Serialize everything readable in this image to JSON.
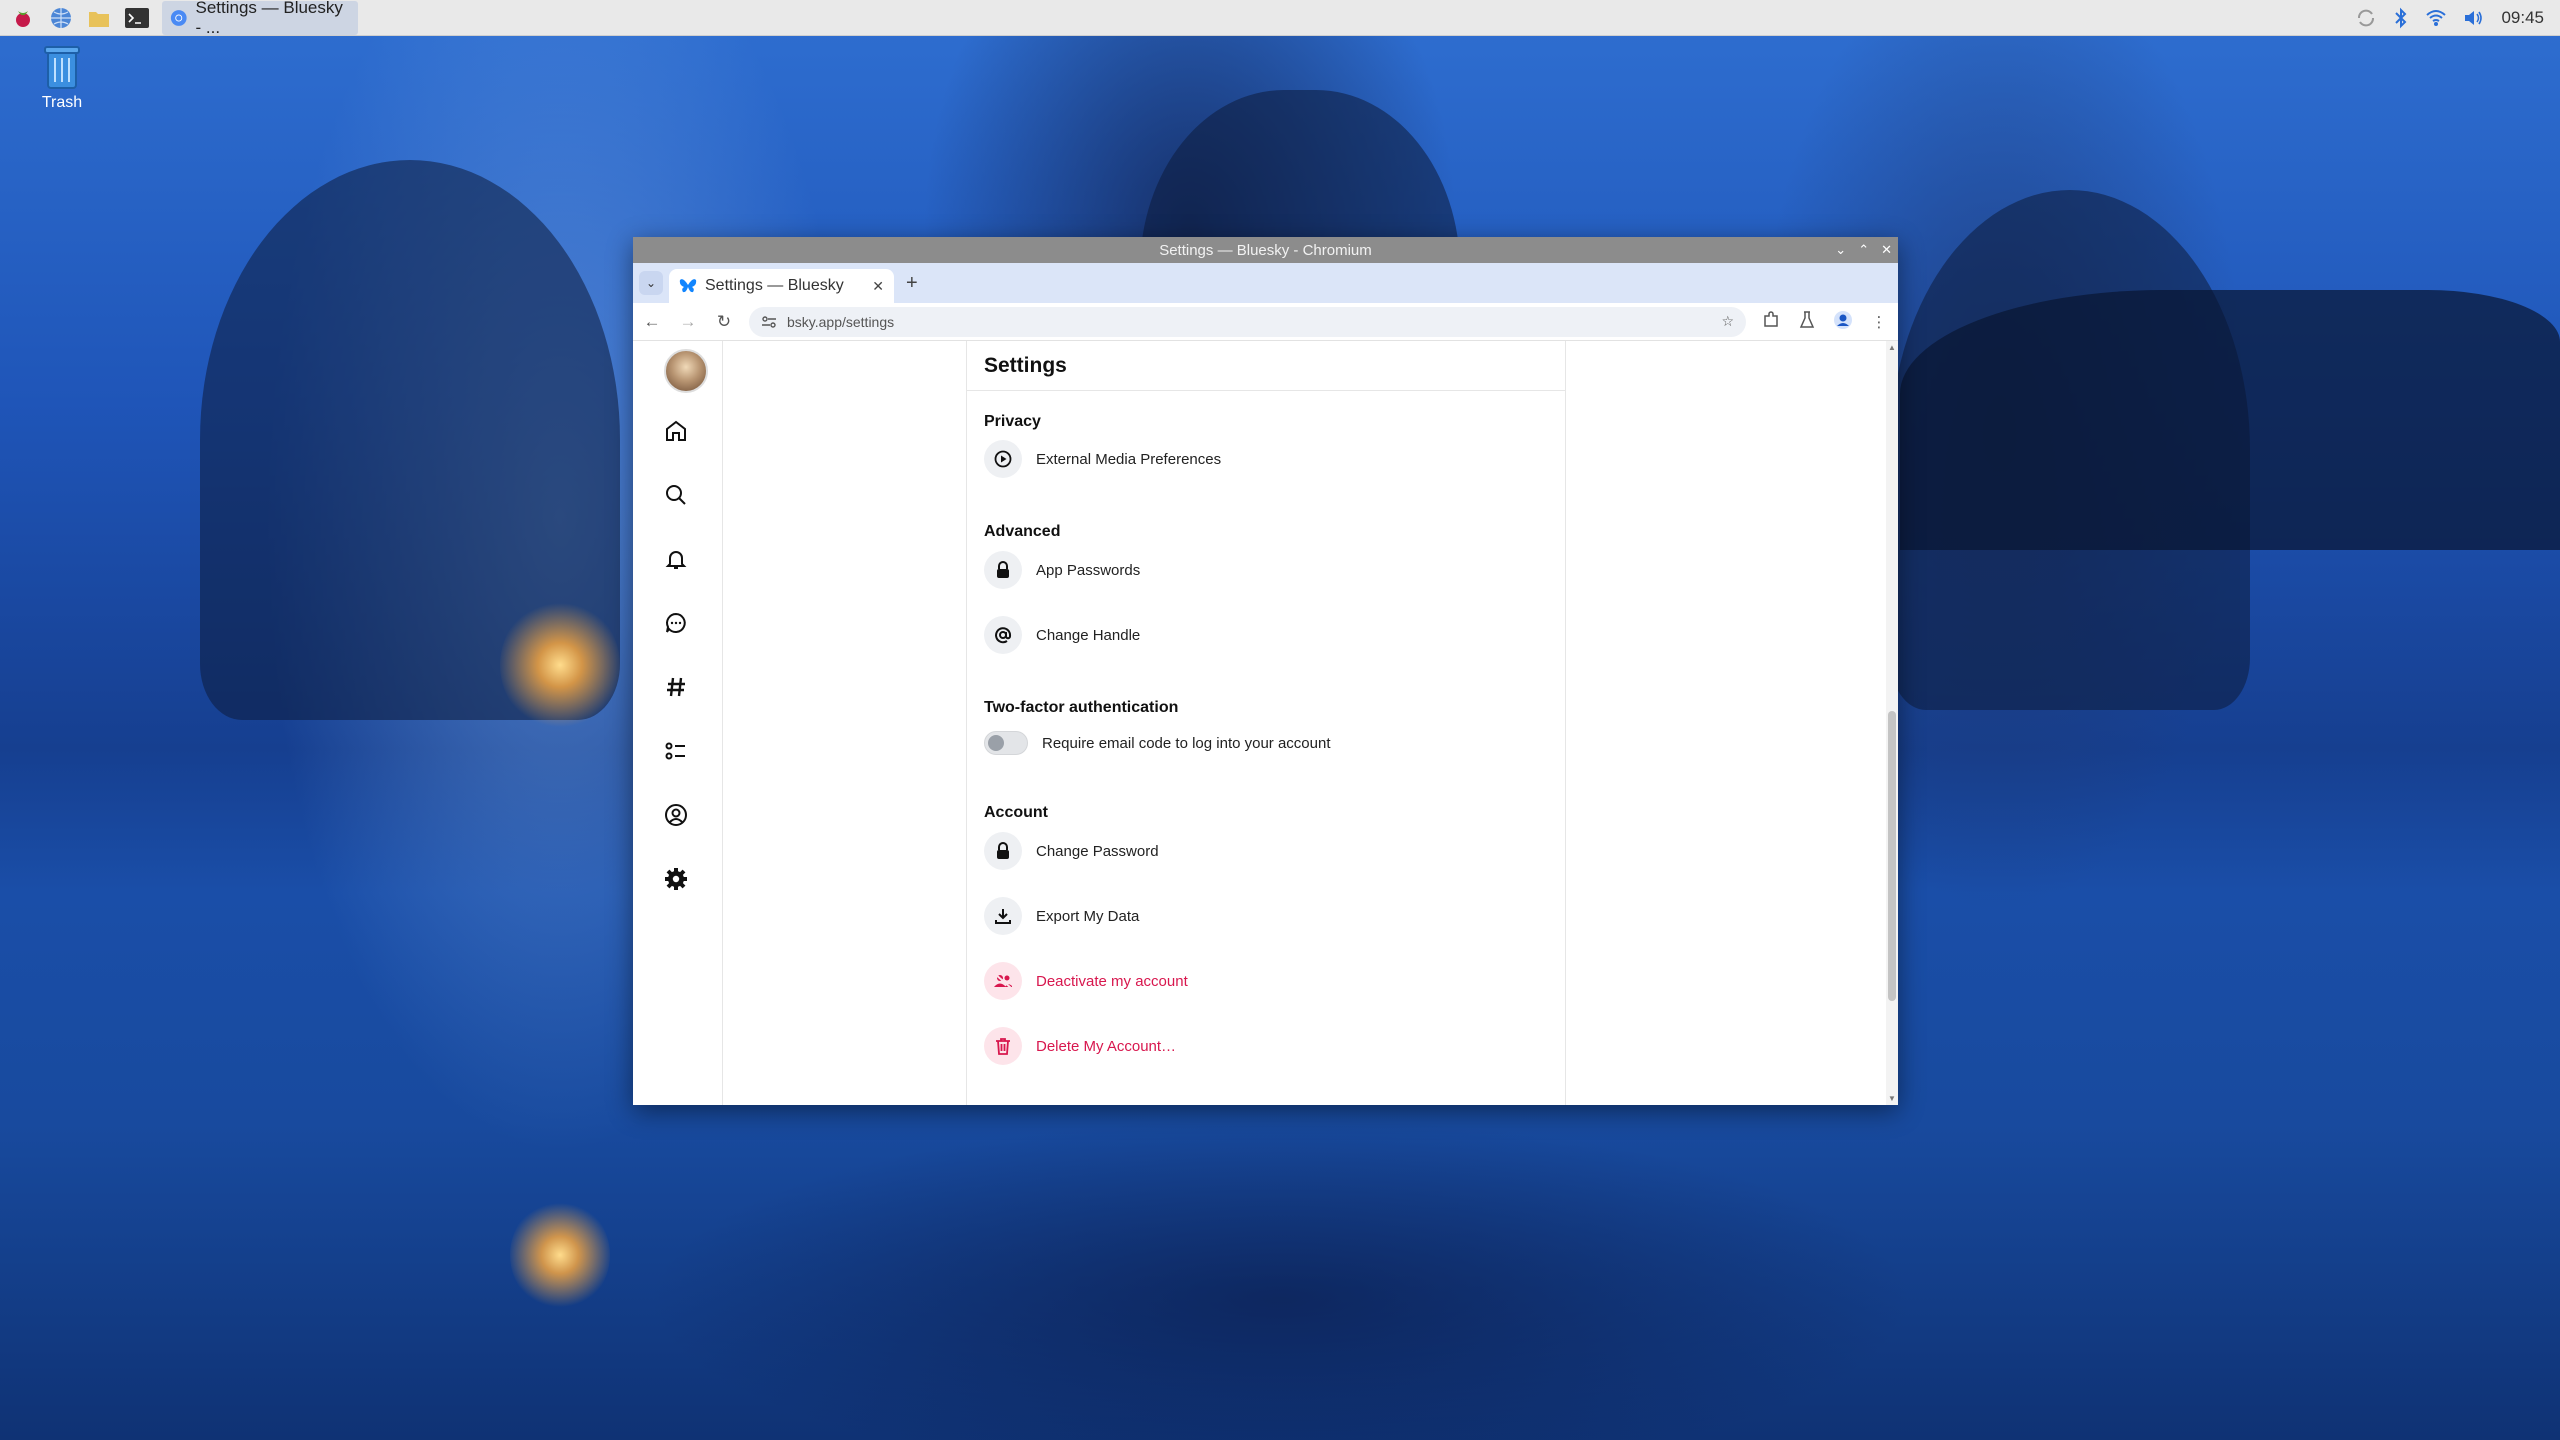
{
  "taskbar": {
    "task_label": "Settings — Bluesky - ...",
    "clock": "09:45"
  },
  "desktop": {
    "trash_label": "Trash"
  },
  "window": {
    "title": "Settings — Bluesky - Chromium"
  },
  "tab": {
    "title": "Settings — Bluesky"
  },
  "address_bar": {
    "url": "bsky.app/settings"
  },
  "sidebar": {
    "items": [
      "home-icon",
      "search-icon",
      "notifications-icon",
      "chat-icon",
      "feeds-icon",
      "lists-icon",
      "profile-icon",
      "settings-icon"
    ]
  },
  "settings": {
    "title": "Settings",
    "privacy": {
      "title": "Privacy",
      "external_media": "External Media Preferences"
    },
    "advanced": {
      "title": "Advanced",
      "app_passwords": "App Passwords",
      "change_handle": "Change Handle"
    },
    "two_factor": {
      "title": "Two-factor authentication",
      "email_code": "Require email code to log into your account",
      "enabled": false
    },
    "account": {
      "title": "Account",
      "change_password": "Change Password",
      "export_data": "Export My Data",
      "deactivate": "Deactivate my account",
      "delete": "Delete My Account…"
    }
  },
  "colors": {
    "danger": "#d8174e",
    "tabstrip": "#dbe5f8",
    "titlebar": "#8c8c8c"
  }
}
